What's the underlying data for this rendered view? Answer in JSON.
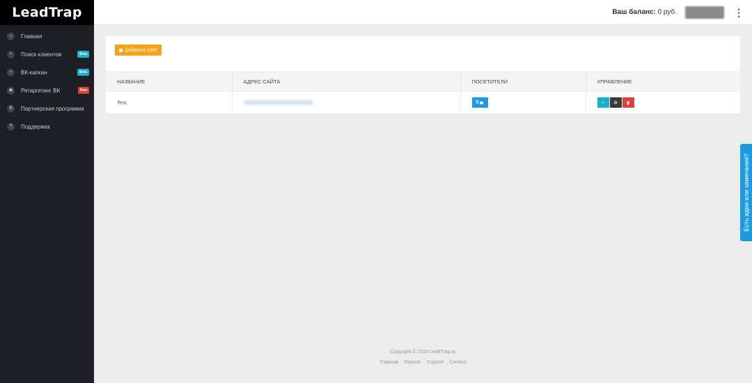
{
  "sidebar": {
    "logo": "LeadTrap",
    "items": [
      {
        "label": "Главная",
        "icon": "⌂",
        "badge": null
      },
      {
        "label": "Поиск клиентов",
        "icon": "▪",
        "badge": "Beta"
      },
      {
        "label": "ВК-капкан",
        "icon": "▪",
        "badge": "Beta"
      },
      {
        "label": "Ретаргетинг ВК",
        "icon": "◉",
        "badge": "New"
      },
      {
        "label": "Партнерская программа",
        "icon": "$",
        "badge": null
      },
      {
        "label": "Поддержка",
        "icon": "?",
        "badge": null
      }
    ]
  },
  "header": {
    "balance_label": "Ваш баланс:",
    "balance_value": " 0 руб.",
    "menu_icon": "⋮"
  },
  "main": {
    "add_button": "Добавить сайт",
    "table": {
      "columns": [
        "НАЗВАНИЕ",
        "АДРЕС САЙТА",
        "ПОСЕТИТЕЛИ",
        "УПРАВЛЕНИЕ"
      ],
      "rows": [
        {
          "name": "Test",
          "visitors": "0"
        }
      ]
    },
    "actions": {
      "code_icon": "‹›",
      "settings_icon": "✲",
      "delete_icon": "▮"
    }
  },
  "footer": {
    "copyright": "Copyright © 2015 LeadTrap.ru",
    "links": [
      "Главная",
      "Reports",
      "Support",
      "Contact"
    ]
  },
  "feedback_tab": "Есть идеи или замечания?"
}
